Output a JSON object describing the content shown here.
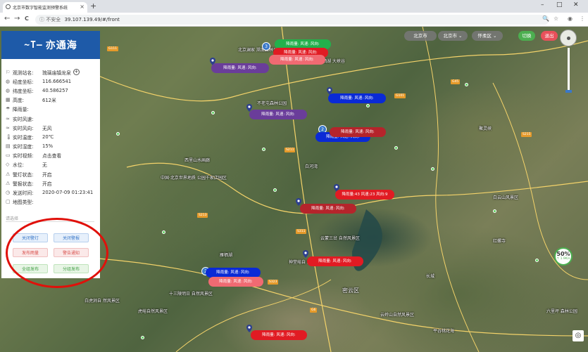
{
  "browser": {
    "tab_title": "北京市数字智能监测预警系统",
    "tab_close": "×",
    "new_tab": "+",
    "minimize": "–",
    "maximize": "□",
    "close": "✕",
    "back": "←",
    "forward": "→",
    "reload": "C",
    "security": "ⓘ 不安全",
    "url": "39.107.139.49/#/front",
    "zoom_icon": "🔍",
    "star_icon": "☆",
    "profile_icon": "◉",
    "menu_icon": "⋮"
  },
  "sidebar": {
    "logo_mark": "~T—",
    "logo_text": "亦通海",
    "info": [
      {
        "icon": "⚐",
        "label": "观测站名:",
        "value": "琉璃庙镇龙泉"
      },
      {
        "icon": "◍",
        "label": "经度坐标:",
        "value": "116.666541"
      },
      {
        "icon": "◍",
        "label": "纬度坐标:",
        "value": "40.586257"
      },
      {
        "icon": "▦",
        "label": "高度:",
        "value": "612米"
      },
      {
        "icon": "☂",
        "label": "降雨量:",
        "value": ""
      },
      {
        "icon": "≈",
        "label": "实时风速:",
        "value": ""
      },
      {
        "icon": "≈",
        "label": "实时风向:",
        "value": "无风"
      },
      {
        "icon": "🌡",
        "label": "实时温度:",
        "value": "20℃"
      },
      {
        "icon": "▤",
        "label": "实时湿度:",
        "value": "15%"
      },
      {
        "icon": "▭",
        "label": "实时视频:",
        "value": "点击查看"
      },
      {
        "icon": "◇",
        "label": "水位:",
        "value": "无"
      },
      {
        "icon": "⚠",
        "label": "警灯状态:",
        "value": "开启"
      },
      {
        "icon": "⚠",
        "label": "警报状态:",
        "value": "开启"
      },
      {
        "icon": "◷",
        "label": "发送时间:",
        "value": "2020-07-09 01:23:41"
      },
      {
        "icon": "▢",
        "label": "地图类型:",
        "value": ""
      }
    ],
    "select_placeholder": "请选择",
    "buttons": {
      "close_light": "关闭警灯",
      "close_alarm": "关闭警报",
      "publish_rain": "发布雨量",
      "alarm_notice": "警告通知",
      "publish_all": "全组发布",
      "publish_group": "分组发布"
    }
  },
  "topbar": {
    "city1": "北京市",
    "city2": "北京市 ⌄",
    "district": "怀柔区 ⌄",
    "switch": "切换",
    "logout": "退出"
  },
  "zoom": {
    "percent": "50%",
    "sub": "↑ 1.9K/s"
  },
  "stations": {
    "rain_wind": "降雨量: 风速: 风向:",
    "rain_43": "降雨量:43 风速:23 风向:9",
    "cluster_3": "3",
    "cluster_2a": "2",
    "cluster_2b": "2"
  },
  "places": [
    "北京澜家 溯发森林公园",
    "北京雁栖湖 大峡谷",
    "云蒙三岔 自然风景区",
    "神堂峪自 然风景区",
    "白河湾",
    "西里山水画廊",
    "不老屯森林公园",
    "中国·北京世界地质 公园千家店园区",
    "十三陵明日 自然风景区",
    "云岭山自然风景区",
    "密云区",
    "虎峪自然风景区",
    "雁栖湖",
    "长城",
    "六里坪 森林公园",
    "白云山风景区",
    "平谷桃花海",
    "聚灵峡",
    "白虎涧自 然风景区",
    "红螺寺"
  ],
  "roads": [
    "G111",
    "S211",
    "G45",
    "S311",
    "S213",
    "G101",
    "S215",
    "G6",
    "S323"
  ]
}
